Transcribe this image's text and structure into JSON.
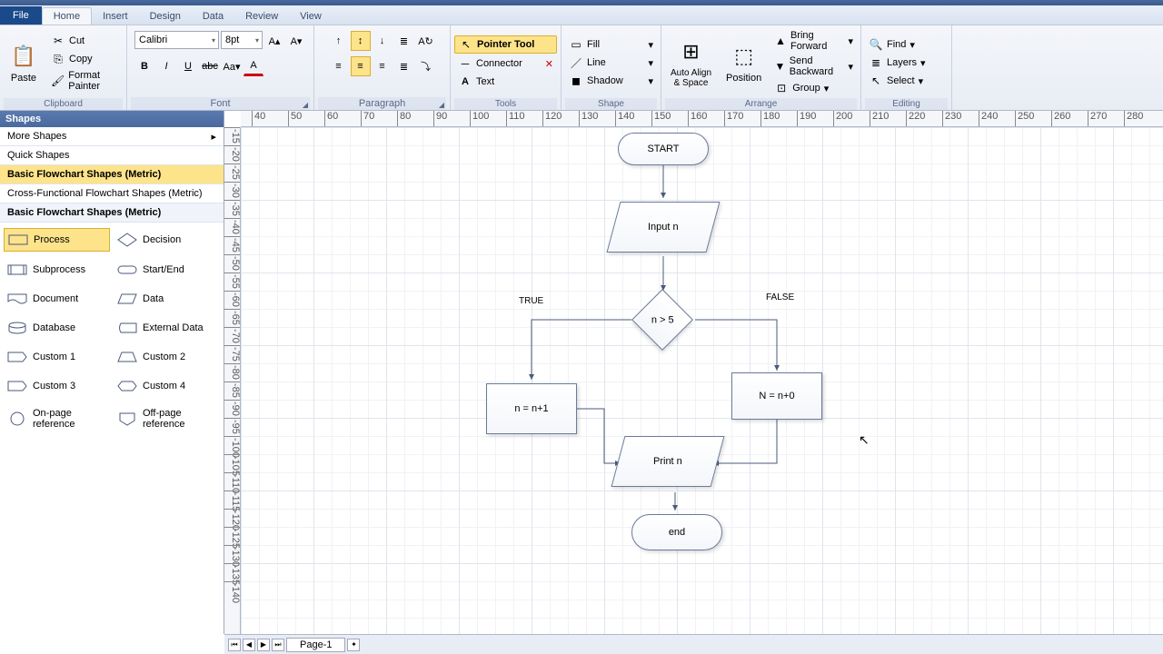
{
  "tabs": {
    "file": "File",
    "home": "Home",
    "insert": "Insert",
    "design": "Design",
    "data": "Data",
    "review": "Review",
    "view": "View"
  },
  "clipboard": {
    "paste": "Paste",
    "cut": "Cut",
    "copy": "Copy",
    "fmt": "Format Painter",
    "label": "Clipboard"
  },
  "font": {
    "name": "Calibri",
    "size": "8pt",
    "label": "Font"
  },
  "paragraph": {
    "label": "Paragraph"
  },
  "tools": {
    "pointer": "Pointer Tool",
    "connector": "Connector",
    "text": "Text",
    "label": "Tools"
  },
  "shape": {
    "fill": "Fill",
    "line": "Line",
    "shadow": "Shadow",
    "label": "Shape"
  },
  "arrange": {
    "auto": "Auto Align\n& Space",
    "position": "Position",
    "fwd": "Bring Forward",
    "bwd": "Send Backward",
    "group": "Group",
    "label": "Arrange"
  },
  "editing": {
    "find": "Find",
    "layers": "Layers",
    "select": "Select",
    "label": "Editing"
  },
  "shapes_panel": {
    "header": "Shapes",
    "more": "More Shapes",
    "quick": "Quick Shapes",
    "cat1": "Basic Flowchart Shapes (Metric)",
    "cat2": "Cross-Functional Flowchart Shapes (Metric)",
    "cat3": "Basic Flowchart Shapes (Metric)",
    "items": [
      "Process",
      "Decision",
      "Subprocess",
      "Start/End",
      "Document",
      "Data",
      "Database",
      "External Data",
      "Custom 1",
      "Custom 2",
      "Custom 3",
      "Custom 4",
      "On-page reference",
      "Off-page reference"
    ]
  },
  "flow": {
    "start": "START",
    "input": "Input n",
    "cond": "n > 5",
    "true": "TRUE",
    "false": "FALSE",
    "left": "n = n+1",
    "right": "N = n+0",
    "print": "Print n",
    "end": "end"
  },
  "ruler_h": [
    "40",
    "50",
    "60",
    "70",
    "80",
    "90",
    "100",
    "110",
    "120",
    "130",
    "140",
    "150",
    "160",
    "170",
    "180",
    "190",
    "200",
    "210",
    "220",
    "230",
    "240",
    "250",
    "260",
    "270",
    "280"
  ],
  "ruler_v": [
    "-15",
    "-20",
    "-25",
    "-30",
    "-35",
    "-40",
    "-45",
    "-50",
    "-55",
    "-60",
    "-65",
    "-70",
    "-75",
    "-80",
    "-85",
    "-90",
    "-95",
    "-100",
    "-105",
    "-110",
    "-115",
    "-120",
    "-125",
    "-130",
    "-135",
    "-140"
  ],
  "page": "Page-1"
}
